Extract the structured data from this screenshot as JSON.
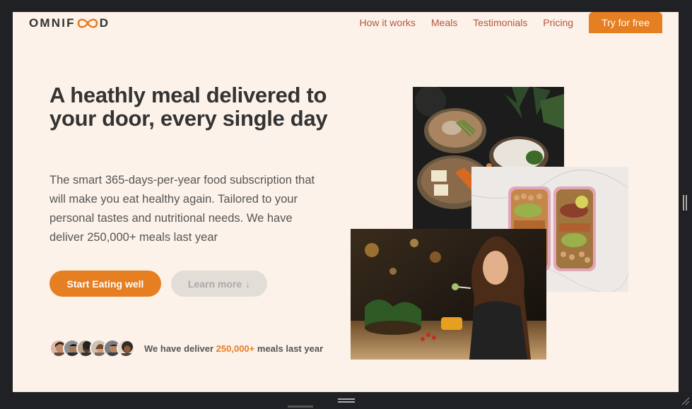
{
  "header": {
    "logo_left": "OMNIF",
    "logo_right": "D",
    "nav": [
      "How it works",
      "Meals",
      "Testimonials",
      "Pricing"
    ],
    "cta": "Try for free"
  },
  "hero": {
    "title": "A heathly meal delivered to your door, every single day",
    "description": "The smart 365-days-per-year food subscription that will make you eat healthy again. Tailored to your personal tastes and nutritional needs. We have deliver 250,000+ meals last year",
    "primary_button": "Start Eating well",
    "secondary_button": "Learn more",
    "secondary_arrow": "↓",
    "customers_prefix": "We have deliver",
    "customers_count": "250,000+",
    "customers_suffix": "meals last year"
  },
  "colors": {
    "accent": "#e67e22",
    "nav_link": "#b3563e",
    "background": "#fdf2e9",
    "text_dark": "#333333"
  },
  "icons": [
    "logo-loop-icon",
    "down-arrow-icon",
    "resize-grip-icon"
  ]
}
